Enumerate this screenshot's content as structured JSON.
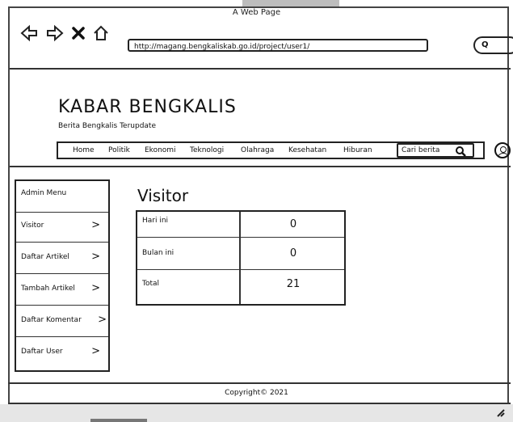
{
  "window": {
    "title": "A Web Page"
  },
  "browser": {
    "url": "http://magang.bengkaliskab.go.id/project/user1/",
    "search_icon": "Q",
    "nav_icons": [
      "back-arrow-icon",
      "forward-arrow-icon",
      "close-icon",
      "home-icon"
    ]
  },
  "site": {
    "brand": "KABAR BENGKALIS",
    "tagline": "Berita Bengkalis Terupdate",
    "menu": [
      "Home",
      "Politik",
      "Ekonomi",
      "Teknologi",
      "Olahraga",
      "Kesehatan",
      "Hiburan"
    ],
    "search_placeholder": "Cari berita"
  },
  "sidebar": {
    "header": "Admin Menu",
    "items": [
      {
        "label": "Visitor",
        "chevron": ">"
      },
      {
        "label": "Daftar Artikel",
        "chevron": ">"
      },
      {
        "label": "Tambah Artikel",
        "chevron": ">"
      },
      {
        "label": "Daftar Komentar",
        "chevron": ">"
      },
      {
        "label": "Daftar User",
        "chevron": ">"
      }
    ]
  },
  "main": {
    "title": "Visitor",
    "stats": [
      {
        "label": "Hari ini",
        "value": "0"
      },
      {
        "label": "Bulan ini",
        "value": "0"
      },
      {
        "label": "Total",
        "value": "21"
      }
    ]
  },
  "footer": {
    "copyright": "Copyright© 2021"
  }
}
